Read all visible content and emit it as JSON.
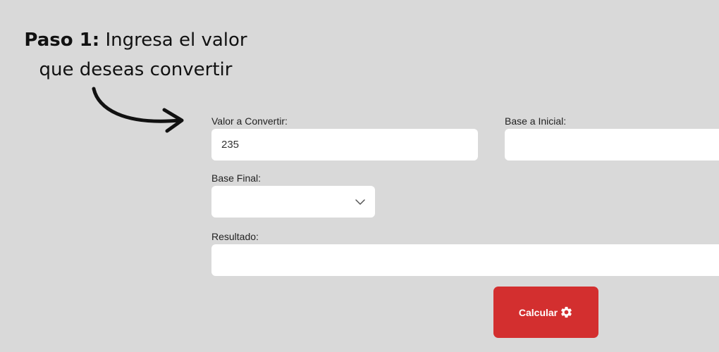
{
  "instruction": {
    "step_label": "Paso 1:",
    "line1_rest": "Ingresa el valor",
    "line2": "que deseas convertir"
  },
  "form": {
    "valor_label": "Valor a Convertir:",
    "valor_value": "235",
    "base_inicial_label": "Base a Inicial:",
    "base_inicial_value": "",
    "base_final_label": "Base Final:",
    "base_final_selected": "",
    "resultado_label": "Resultado:",
    "resultado_value": ""
  },
  "button": {
    "label": "Calcular",
    "icon": "gear-icon",
    "color": "#d32f2f"
  },
  "colors": {
    "background": "#d9d9d9",
    "field": "#ffffff"
  }
}
